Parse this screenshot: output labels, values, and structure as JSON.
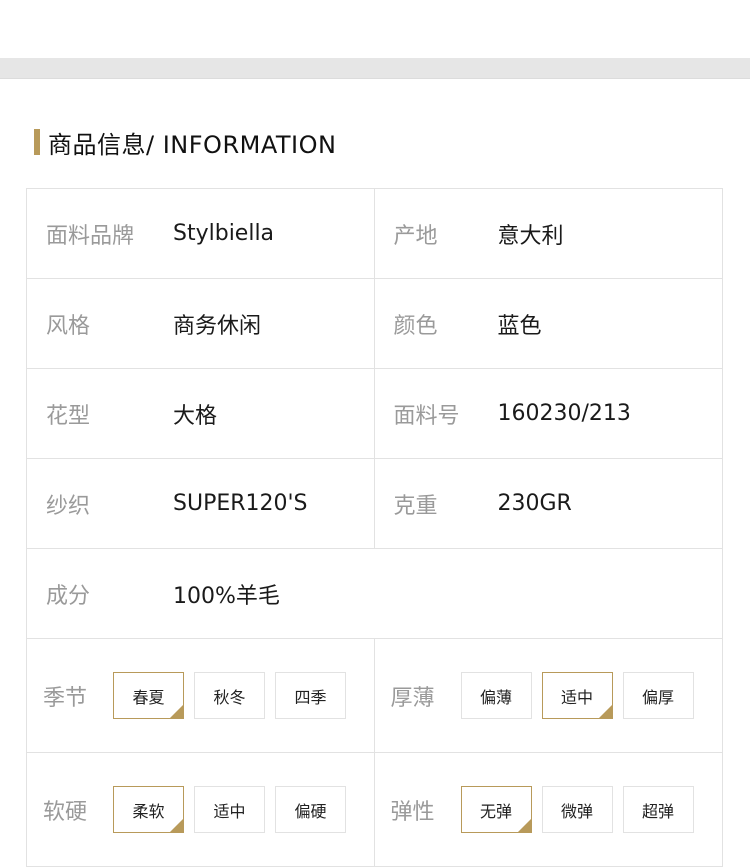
{
  "section": {
    "title": "商品信息/ INFORMATION"
  },
  "accent_color": "#b89a5a",
  "rows": [
    {
      "left": {
        "label": "面料品牌",
        "value": "Stylbiella"
      },
      "right": {
        "label": "产地",
        "value": "意大利"
      }
    },
    {
      "left": {
        "label": "风格",
        "value": "商务休闲"
      },
      "right": {
        "label": "颜色",
        "value": "蓝色"
      }
    },
    {
      "left": {
        "label": "花型",
        "value": "大格"
      },
      "right": {
        "label": "面料号",
        "value": "160230/213"
      }
    },
    {
      "left": {
        "label": "纱织",
        "value": "SUPER120'S"
      },
      "right": {
        "label": "克重",
        "value": "230GR"
      }
    }
  ],
  "composition": {
    "label": "成分",
    "value": "100%羊毛"
  },
  "attributes": {
    "season": {
      "label": "季节",
      "options": [
        "春夏",
        "秋冬",
        "四季"
      ],
      "selected": "春夏"
    },
    "thickness": {
      "label": "厚薄",
      "options": [
        "偏薄",
        "适中",
        "偏厚"
      ],
      "selected": "适中"
    },
    "hardness": {
      "label": "软硬",
      "options": [
        "柔软",
        "适中",
        "偏硬"
      ],
      "selected": "柔软"
    },
    "elasticity": {
      "label": "弹性",
      "options": [
        "无弹",
        "微弹",
        "超弹"
      ],
      "selected": "无弹"
    }
  }
}
